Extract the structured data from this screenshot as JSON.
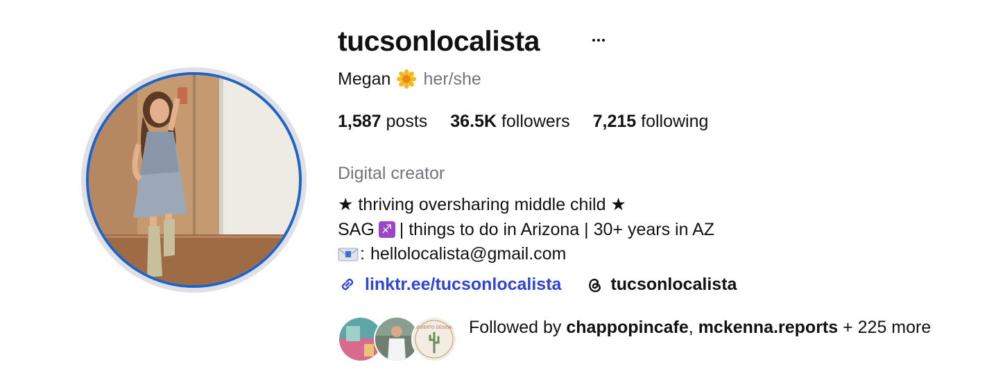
{
  "profile": {
    "username": "tucsonlocalista",
    "display_name": "Megan",
    "name_emoji_icon": "sunflower-icon",
    "pronouns": "her/she",
    "more_options_icon": "ellipsis-icon"
  },
  "stats": {
    "posts_count": "1,587",
    "posts_label": "posts",
    "followers_count": "36.5K",
    "followers_label": "followers",
    "following_count": "7,215",
    "following_label": "following"
  },
  "bio": {
    "category": "Digital creator",
    "line1": "★ thriving oversharing middle child ★",
    "line2_before": "SAG",
    "line2_emoji": "♐",
    "line2_after": "| things to do in Arizona | 30+ years in AZ",
    "line3_prefix": ":",
    "line3_email": "hellolocalista@gmail.com",
    "line3_icon": "envelope-icon"
  },
  "links": {
    "website": "linktr.ee/tucsonlocalista",
    "website_icon": "link-icon",
    "threads_handle": "tucsonlocalista",
    "threads_icon": "threads-icon"
  },
  "followed_by": {
    "prefix": "Followed by",
    "user1": "chappopincafe",
    "separator": ",",
    "user2": "mckenna.reports",
    "suffix": "+ 225 more",
    "avatar3_text": "DESIERTO DESIGNS"
  },
  "colors": {
    "link": "#2f45d8",
    "secondary_text": "#73737a",
    "story_ring": "#1e63c8"
  }
}
